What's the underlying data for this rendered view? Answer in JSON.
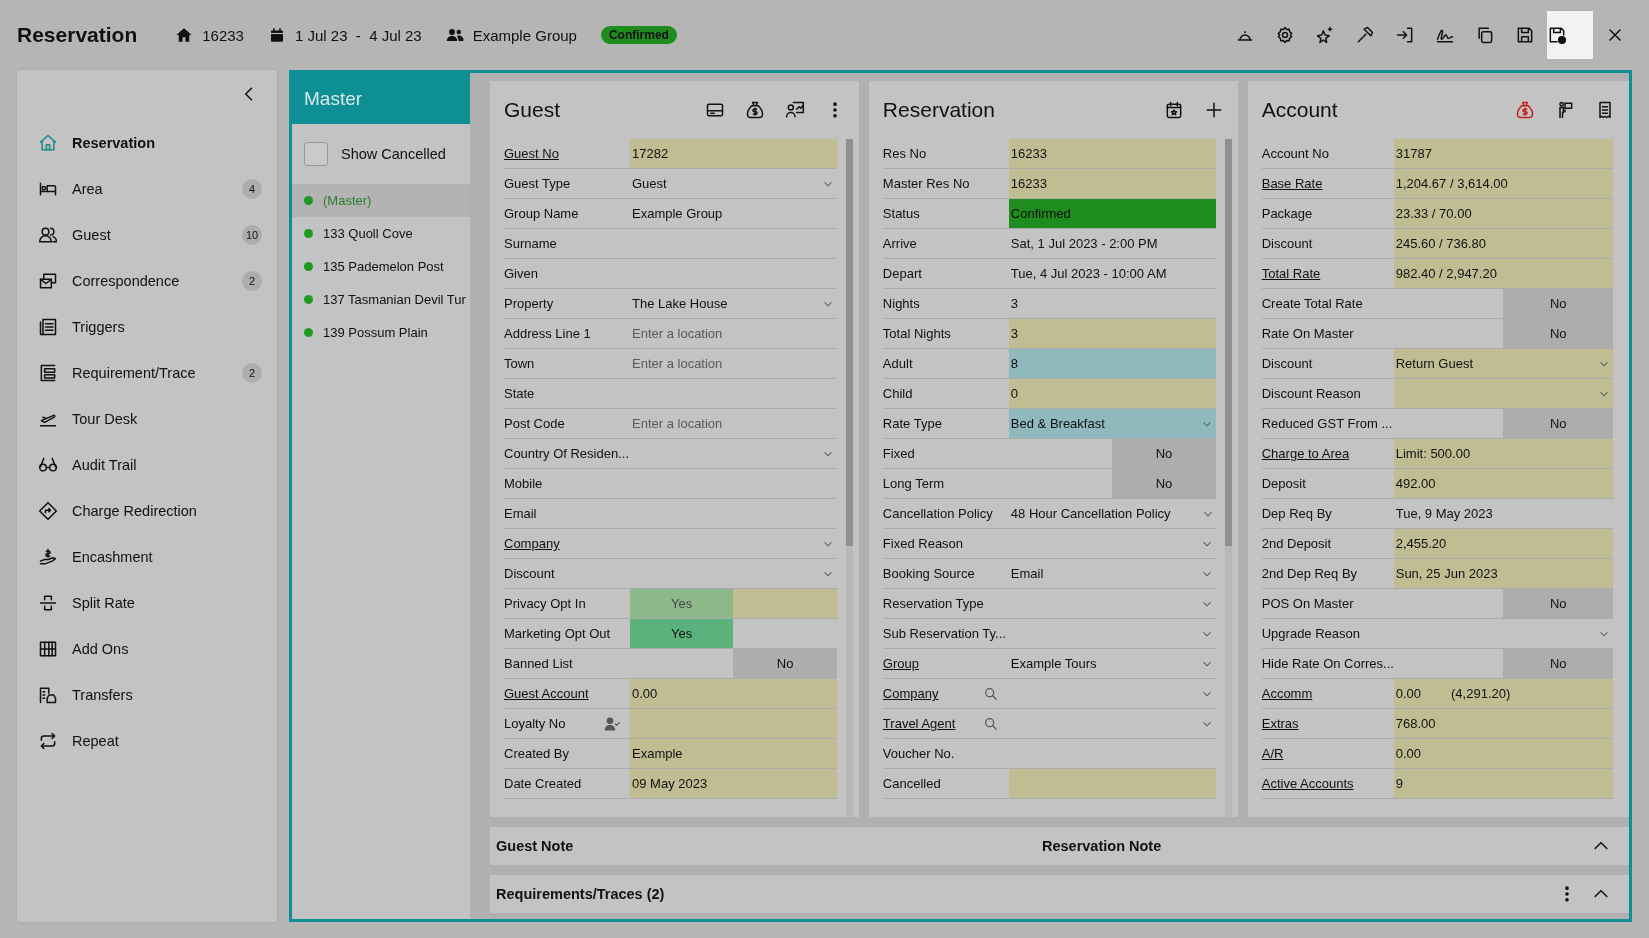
{
  "header": {
    "title": "Reservation",
    "res_no": "16233",
    "dates": "1 Jul 23  -  4 Jul 23",
    "group": "Example Group",
    "status": "Confirmed"
  },
  "toolbar": [
    {
      "selected": false
    },
    {
      "selected": false
    },
    {
      "selected": false
    },
    {
      "selected": false
    },
    {
      "selected": false
    },
    {
      "selected": false
    },
    {
      "selected": false
    },
    {
      "selected": false
    },
    {
      "selected": true
    },
    {
      "selected": false
    }
  ],
  "sidebar": {
    "items": [
      {
        "label": "Reservation",
        "selected": true
      },
      {
        "label": "Area",
        "count": "4",
        "selected": false
      },
      {
        "label": "Guest",
        "count": "10",
        "selected": false
      },
      {
        "label": "Correspondence",
        "count": "2",
        "selected": false
      },
      {
        "label": "Triggers",
        "selected": false
      },
      {
        "label": "Requirement/Trace",
        "count": "2",
        "selected": false
      },
      {
        "label": "Tour Desk",
        "selected": false
      },
      {
        "label": "Audit Trail",
        "selected": false
      },
      {
        "label": "Charge Redirection",
        "selected": false
      },
      {
        "label": "Encashment",
        "selected": false
      },
      {
        "label": "Split Rate",
        "selected": false
      },
      {
        "label": "Add Ons",
        "selected": false
      },
      {
        "label": "Transfers",
        "selected": false
      },
      {
        "label": "Repeat",
        "selected": false
      }
    ]
  },
  "master": {
    "title": "Master",
    "show_cancelled": {
      "label": "Show Cancelled",
      "checked": false
    },
    "items": [
      {
        "label": "(Master)",
        "selected": true,
        "color": "#1f9a1f"
      },
      {
        "label": "133 Quoll Cove",
        "selected": false,
        "color": "#1f9a1f"
      },
      {
        "label": "135 Pademelon Post",
        "selected": false,
        "color": "#1f9a1f"
      },
      {
        "label": "137 Tasmanian Devil Tur",
        "selected": false,
        "color": "#1f9a1f"
      },
      {
        "label": "139 Possum Plain",
        "selected": false,
        "color": "#1f9a1f"
      }
    ]
  },
  "guest": {
    "title": "Guest",
    "fields": [
      {
        "label": "Guest No",
        "link": true,
        "kind": "text",
        "value": "17282",
        "color": "#c0bd93"
      },
      {
        "label": "Guest Type",
        "link": false,
        "kind": "select",
        "value": "Guest"
      },
      {
        "label": "Group Name",
        "link": false,
        "kind": "text",
        "value": "Example Group"
      },
      {
        "label": "Surname",
        "link": false,
        "kind": "text"
      },
      {
        "label": "Given",
        "link": false,
        "kind": "text"
      },
      {
        "label": "Property",
        "link": false,
        "kind": "select",
        "value": "The Lake House"
      },
      {
        "label": "Address Line 1",
        "link": false,
        "kind": "text",
        "placeholder": "Enter a location"
      },
      {
        "label": "Town",
        "link": false,
        "kind": "text",
        "placeholder": "Enter a location"
      },
      {
        "label": "State",
        "link": false,
        "kind": "text"
      },
      {
        "label": "Post Code",
        "link": false,
        "kind": "text",
        "placeholder": "Enter a location"
      },
      {
        "label": "Country Of Residen...",
        "link": false,
        "kind": "select"
      },
      {
        "label": "Mobile",
        "link": false,
        "kind": "text"
      },
      {
        "label": "Email",
        "link": false,
        "kind": "text"
      },
      {
        "label": "Company",
        "link": true,
        "kind": "select"
      },
      {
        "label": "Discount",
        "link": false,
        "kind": "select"
      },
      {
        "label": "Privacy Opt In",
        "link": false,
        "kind": "toggle",
        "value": "Yes",
        "on": true,
        "disabled": true,
        "color": "#c0bd93"
      },
      {
        "label": "Marketing Opt Out",
        "link": false,
        "kind": "toggle",
        "value": "Yes",
        "on": true,
        "disabled": false
      },
      {
        "label": "Banned List",
        "link": false,
        "kind": "toggle",
        "value": "No",
        "on": false,
        "disabled": false
      },
      {
        "label": "Guest Account",
        "link": true,
        "kind": "text",
        "value": "0.00",
        "color": "#c0bd93"
      },
      {
        "label": "Loyalty No",
        "link": false,
        "kind": "member",
        "color": "#c0bd93"
      },
      {
        "label": "Created By",
        "link": false,
        "kind": "text",
        "value": "Example",
        "color": "#c0bd93"
      },
      {
        "label": "Date Created",
        "link": false,
        "kind": "text",
        "value": "09 May 2023",
        "color": "#c0bd93"
      }
    ]
  },
  "reservation": {
    "title": "Reservation",
    "fields": [
      {
        "label": "Res No",
        "link": false,
        "kind": "text",
        "value": "16233",
        "color": "#c0bd93"
      },
      {
        "label": "Master Res No",
        "link": false,
        "kind": "text",
        "value": "16233",
        "color": "#c0bd93"
      },
      {
        "label": "Status",
        "link": false,
        "kind": "text",
        "value": "Confirmed",
        "color": "#1f8c1f"
      },
      {
        "label": "Arrive",
        "link": false,
        "kind": "text",
        "value": "Sat, 1 Jul 2023 - 2:00 PM"
      },
      {
        "label": "Depart",
        "link": false,
        "kind": "text",
        "value": "Tue, 4 Jul 2023 - 10:00 AM"
      },
      {
        "label": "Nights",
        "link": false,
        "kind": "text",
        "value": "3"
      },
      {
        "label": "Total Nights",
        "link": false,
        "kind": "text",
        "value": "3",
        "color": "#c0bd93"
      },
      {
        "label": "Adult",
        "link": false,
        "kind": "text",
        "value": "8",
        "color": "#8fb9bd"
      },
      {
        "label": "Child",
        "link": false,
        "kind": "text",
        "value": "0",
        "color": "#c0bd93"
      },
      {
        "label": "Rate Type",
        "link": false,
        "kind": "select",
        "value": "Bed & Breakfast",
        "color": "#8fb9bd"
      },
      {
        "label": "Fixed",
        "link": false,
        "kind": "toggle",
        "value": "No",
        "on": false,
        "disabled": false
      },
      {
        "label": "Long Term",
        "link": false,
        "kind": "toggle",
        "value": "No",
        "on": false,
        "disabled": false
      },
      {
        "label": "Cancellation Policy",
        "link": false,
        "kind": "select",
        "value": "48 Hour Cancellation Policy"
      },
      {
        "label": "Fixed Reason",
        "link": false,
        "kind": "select"
      },
      {
        "label": "Booking Source",
        "link": false,
        "kind": "select",
        "value": "Email"
      },
      {
        "label": "Reservation Type",
        "link": false,
        "kind": "select"
      },
      {
        "label": "Sub Reservation Ty...",
        "link": false,
        "kind": "select"
      },
      {
        "label": "Group",
        "link": true,
        "kind": "select",
        "value": "Example Tours"
      },
      {
        "label": "Company",
        "link": true,
        "kind": "lookup"
      },
      {
        "label": "Travel Agent",
        "link": true,
        "kind": "lookup"
      },
      {
        "label": "Voucher No.",
        "link": false,
        "kind": "text"
      },
      {
        "label": "Cancelled",
        "link": false,
        "kind": "text",
        "color": "#c0bd93"
      }
    ]
  },
  "account": {
    "title": "Account",
    "fields": [
      {
        "label": "Account No",
        "link": false,
        "kind": "text",
        "value": "31787",
        "color": "#c0bd93"
      },
      {
        "label": "Base Rate",
        "link": true,
        "kind": "text",
        "value": "1,204.67 / 3,614.00",
        "color": "#c0bd93"
      },
      {
        "label": "Package",
        "link": false,
        "kind": "text",
        "value": "23.33 / 70.00",
        "color": "#c0bd93"
      },
      {
        "label": "Discount",
        "link": false,
        "kind": "text",
        "value": "245.60 / 736.80",
        "color": "#c0bd93"
      },
      {
        "label": "Total Rate",
        "link": true,
        "kind": "text",
        "value": "982.40 / 2,947.20",
        "color": "#c0bd93"
      },
      {
        "label": "Create Total Rate",
        "link": false,
        "kind": "toggle",
        "value": "No",
        "on": false,
        "disabled": false
      },
      {
        "label": "Rate On Master",
        "link": false,
        "kind": "toggle",
        "value": "No",
        "on": false,
        "disabled": false
      },
      {
        "label": "Discount",
        "link": false,
        "kind": "select",
        "value": "Return Guest",
        "color": "#c0bd93"
      },
      {
        "label": "Discount Reason",
        "link": false,
        "kind": "select",
        "color": "#c0bd93"
      },
      {
        "label": "Reduced GST From ...",
        "link": false,
        "kind": "toggle",
        "value": "No",
        "on": false,
        "disabled": false
      },
      {
        "label": "Charge to Area",
        "link": true,
        "kind": "text",
        "value": "Limit: 500.00",
        "color": "#c0bd93"
      },
      {
        "label": "Deposit",
        "link": false,
        "kind": "text",
        "value": "492.00",
        "color": "#c0bd93"
      },
      {
        "label": "Dep Req By",
        "link": false,
        "kind": "text",
        "value": "Tue, 9 May 2023"
      },
      {
        "label": "2nd Deposit",
        "link": false,
        "kind": "text",
        "value": "2,455.20",
        "color": "#c0bd93"
      },
      {
        "label": "2nd Dep Req By",
        "link": false,
        "kind": "text",
        "value": "Sun, 25 Jun 2023",
        "color": "#c0bd93"
      },
      {
        "label": "POS On Master",
        "link": false,
        "kind": "toggle",
        "value": "No",
        "on": false,
        "disabled": false
      },
      {
        "label": "Upgrade Reason",
        "link": false,
        "kind": "select"
      },
      {
        "label": "Hide Rate On Corres...",
        "link": false,
        "kind": "toggle",
        "value": "No",
        "on": false,
        "disabled": false
      },
      {
        "label": "Accomm",
        "link": true,
        "kind": "text",
        "value": "0.00",
        "extra": "(4,291.20)",
        "color": "#c0bd93"
      },
      {
        "label": "Extras",
        "link": true,
        "kind": "text",
        "value": "768.00",
        "color": "#c0bd93"
      },
      {
        "label": "A/R",
        "link": true,
        "kind": "text",
        "value": "0.00",
        "color": "#c0bd93"
      },
      {
        "label": "Active Accounts",
        "link": true,
        "kind": "text",
        "value": "9",
        "color": "#c0bd93"
      }
    ]
  },
  "notes": {
    "guest_label": "Guest Note",
    "reservation_label": "Reservation Note",
    "expanded": true
  },
  "requirements": {
    "label": "Requirements/Traces (2)",
    "expanded": true
  }
}
